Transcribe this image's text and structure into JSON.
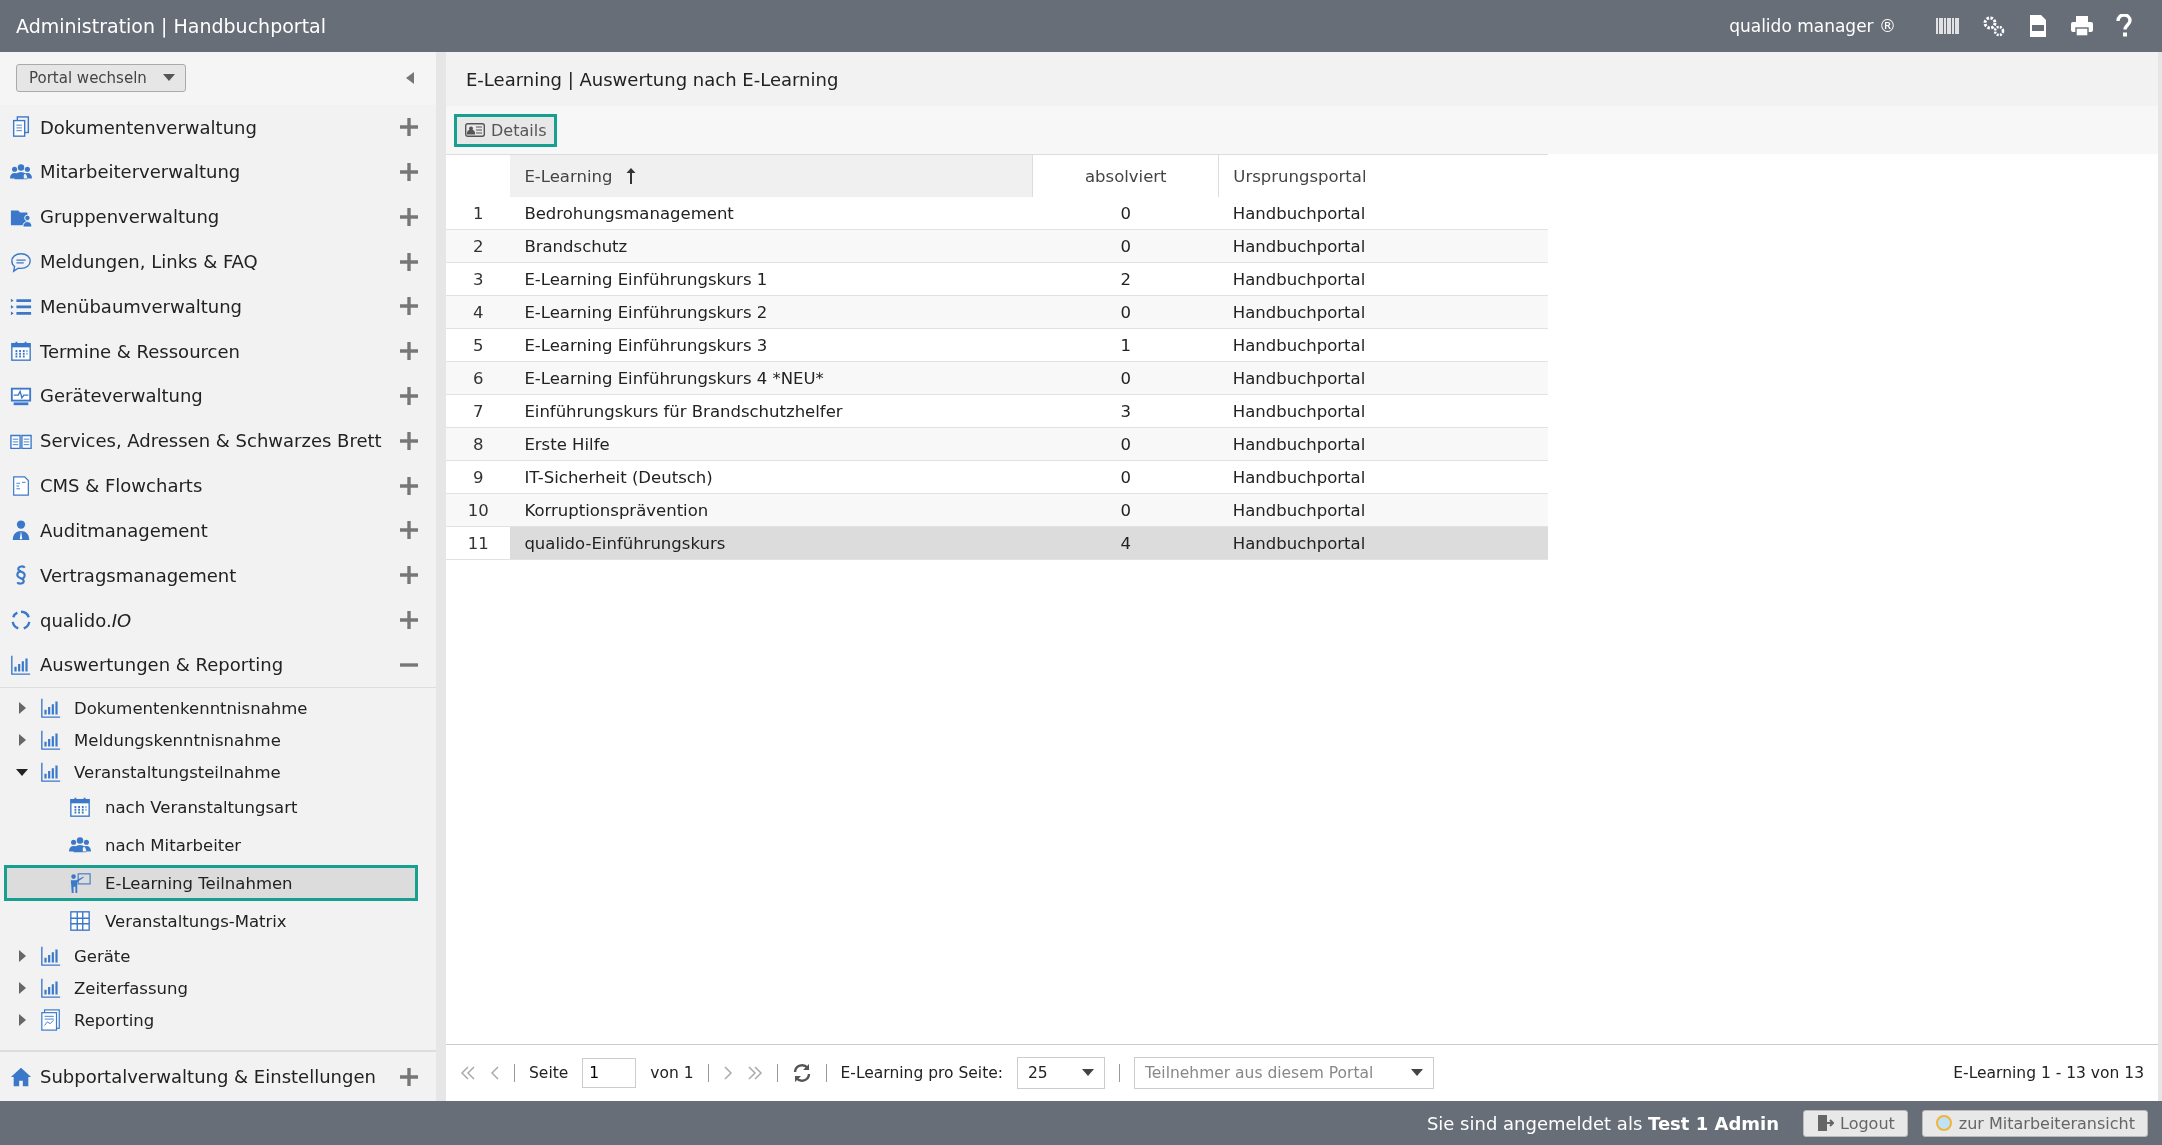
{
  "window": {
    "title": "Administration | Handbuchportal",
    "product": "qualido manager ®"
  },
  "sidebar": {
    "portal_switch": "Portal wechseln",
    "groups": [
      {
        "label": "Dokumentenverwaltung",
        "expanded": false
      },
      {
        "label": "Mitarbeiterverwaltung",
        "expanded": false
      },
      {
        "label": "Gruppenverwaltung",
        "expanded": false
      },
      {
        "label": "Meldungen, Links & FAQ",
        "expanded": false
      },
      {
        "label": "Menübaumverwaltung",
        "expanded": false
      },
      {
        "label": "Termine & Ressourcen",
        "expanded": false
      },
      {
        "label": "Geräteverwaltung",
        "expanded": false
      },
      {
        "label": "Services, Adressen & Schwarzes Brett",
        "expanded": false
      },
      {
        "label": "CMS & Flowcharts",
        "expanded": false
      },
      {
        "label": "Auditmanagement",
        "expanded": false
      },
      {
        "label": "Vertragsmanagement",
        "expanded": false
      },
      {
        "label": "qualido.*IO*",
        "expanded": false
      },
      {
        "label": "Auswertungen & Reporting",
        "expanded": true,
        "children": [
          {
            "label": "Dokumentenkenntnisnahme",
            "expanded": false,
            "selected": false
          },
          {
            "label": "Meldungskenntnisnahme",
            "expanded": false,
            "selected": false
          },
          {
            "label": "Veranstaltungsteilnahme",
            "expanded": true,
            "selected": false,
            "children": [
              {
                "label": "nach Veranstaltungsart",
                "selected": false
              },
              {
                "label": "nach Mitarbeiter",
                "selected": false
              },
              {
                "label": "E-Learning Teilnahmen",
                "selected": true
              },
              {
                "label": "Veranstaltungs-Matrix",
                "selected": false
              }
            ]
          },
          {
            "label": "Geräte",
            "expanded": false,
            "selected": false
          },
          {
            "label": "Zeiterfassung",
            "expanded": false,
            "selected": false
          },
          {
            "label": "Reporting",
            "expanded": false,
            "selected": false
          }
        ]
      }
    ],
    "footer_group": {
      "label": "Subportalverwaltung & Einstellungen",
      "expanded": false
    }
  },
  "main": {
    "breadcrumb": "E-Learning | Auswertung nach E-Learning",
    "toolbar": [
      {
        "label": "Details"
      }
    ],
    "table": {
      "columns": [
        {
          "label": "E-Learning",
          "sorted": true
        },
        {
          "label": "absolviert",
          "sorted": false
        },
        {
          "label": "Ursprungsportal",
          "sorted": false
        }
      ],
      "rows": [
        {
          "index": "1",
          "cells": [
            "Bedrohungsmanagement",
            "0",
            "Handbuchportal"
          ],
          "selected": false
        },
        {
          "index": "2",
          "cells": [
            "Brandschutz",
            "0",
            "Handbuchportal"
          ],
          "selected": false
        },
        {
          "index": "3",
          "cells": [
            "E-Learning Einführungskurs 1",
            "2",
            "Handbuchportal"
          ],
          "selected": false
        },
        {
          "index": "4",
          "cells": [
            "E-Learning Einführungskurs 2",
            "0",
            "Handbuchportal"
          ],
          "selected": false
        },
        {
          "index": "5",
          "cells": [
            "E-Learning Einführungskurs 3",
            "1",
            "Handbuchportal"
          ],
          "selected": false
        },
        {
          "index": "6",
          "cells": [
            "E-Learning Einführungskurs 4 *NEU*",
            "0",
            "Handbuchportal"
          ],
          "selected": false
        },
        {
          "index": "7",
          "cells": [
            "Einführungskurs für Brandschutzhelfer",
            "3",
            "Handbuchportal"
          ],
          "selected": false
        },
        {
          "index": "8",
          "cells": [
            "Erste Hilfe",
            "0",
            "Handbuchportal"
          ],
          "selected": false
        },
        {
          "index": "9",
          "cells": [
            "IT-Sicherheit (Deutsch)",
            "0",
            "Handbuchportal"
          ],
          "selected": false
        },
        {
          "index": "10",
          "cells": [
            "Korruptionsprävention",
            "0",
            "Handbuchportal"
          ],
          "selected": false
        },
        {
          "index": "11",
          "cells": [
            "qualido-Einführungskurs",
            "4",
            "Handbuchportal"
          ],
          "selected": true
        }
      ]
    },
    "pager": {
      "page_label": "Seite",
      "page": "1",
      "of": "von 1",
      "per_page_label": "E-Learning pro Seite:",
      "per_page": "25",
      "filter": "Teilnehmer aus diesem Portal",
      "summary": "E-Learning 1 - 13 von 13",
      "first_disabled": true,
      "next_disabled": true
    }
  },
  "status_bar": {
    "login": "Sie sind angemeldet als **Test 1 Admin**",
    "buttons": [
      {
        "label": "Logout"
      },
      {
        "label": "zur Mitarbeiteransicht"
      }
    ]
  }
}
